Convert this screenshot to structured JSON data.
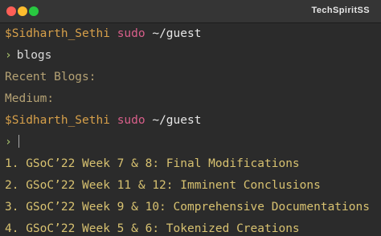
{
  "window": {
    "title": "TechSpiritSS",
    "colors": {
      "close": "#ff5f57",
      "minimize": "#febc2e",
      "maximize": "#28c840"
    }
  },
  "prompt": {
    "user": "$Sidharth_Sethi",
    "command": "sudo",
    "path": "~/guest",
    "symbol": "›"
  },
  "session": {
    "first_command": "blogs",
    "output": [
      "Recent Blogs:",
      "Medium:"
    ],
    "list_items": [
      "1. GSoC’22 Week 7 & 8: Final Modifications",
      "2. GSoC’22 Week 11 & 12: Imminent Conclusions",
      "3. GSoC’22 Week 9 & 10: Comprehensive Documentations",
      "4. GSoC’22 Week 5 & 6: Tokenized Creations"
    ]
  },
  "colors": {
    "user": "#d7a04a",
    "sudo": "#d85f8a",
    "chevron": "#a8c26c",
    "output": "#b5a274",
    "list": "#d7c170"
  }
}
